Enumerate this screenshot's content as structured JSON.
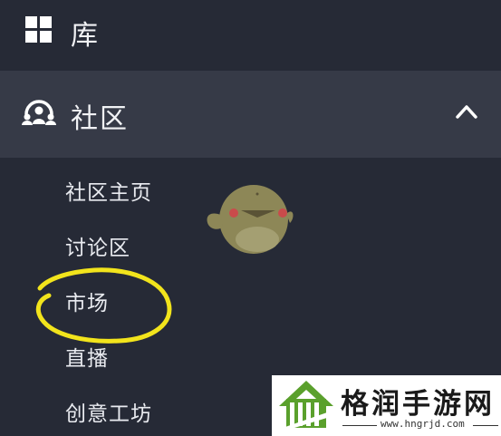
{
  "sidebar": {
    "library": {
      "label": "库",
      "icon": "grid-icon"
    },
    "community": {
      "label": "社区",
      "icon": "community-icon",
      "expanded": true,
      "chevron": "chevron-up-icon"
    },
    "items": [
      {
        "label": "社区主页"
      },
      {
        "label": "讨论区"
      },
      {
        "label": "市场"
      },
      {
        "label": "直播"
      },
      {
        "label": "创意工坊"
      }
    ]
  },
  "annotation": {
    "color": "#f2e41c"
  },
  "watermark": {
    "title": "格润手游网",
    "url": "www.hngrjd.com",
    "color": "#5aa02c"
  },
  "colors": {
    "background": "#262a36",
    "selected_row": "#363a47",
    "text": "#e9ebf0"
  }
}
